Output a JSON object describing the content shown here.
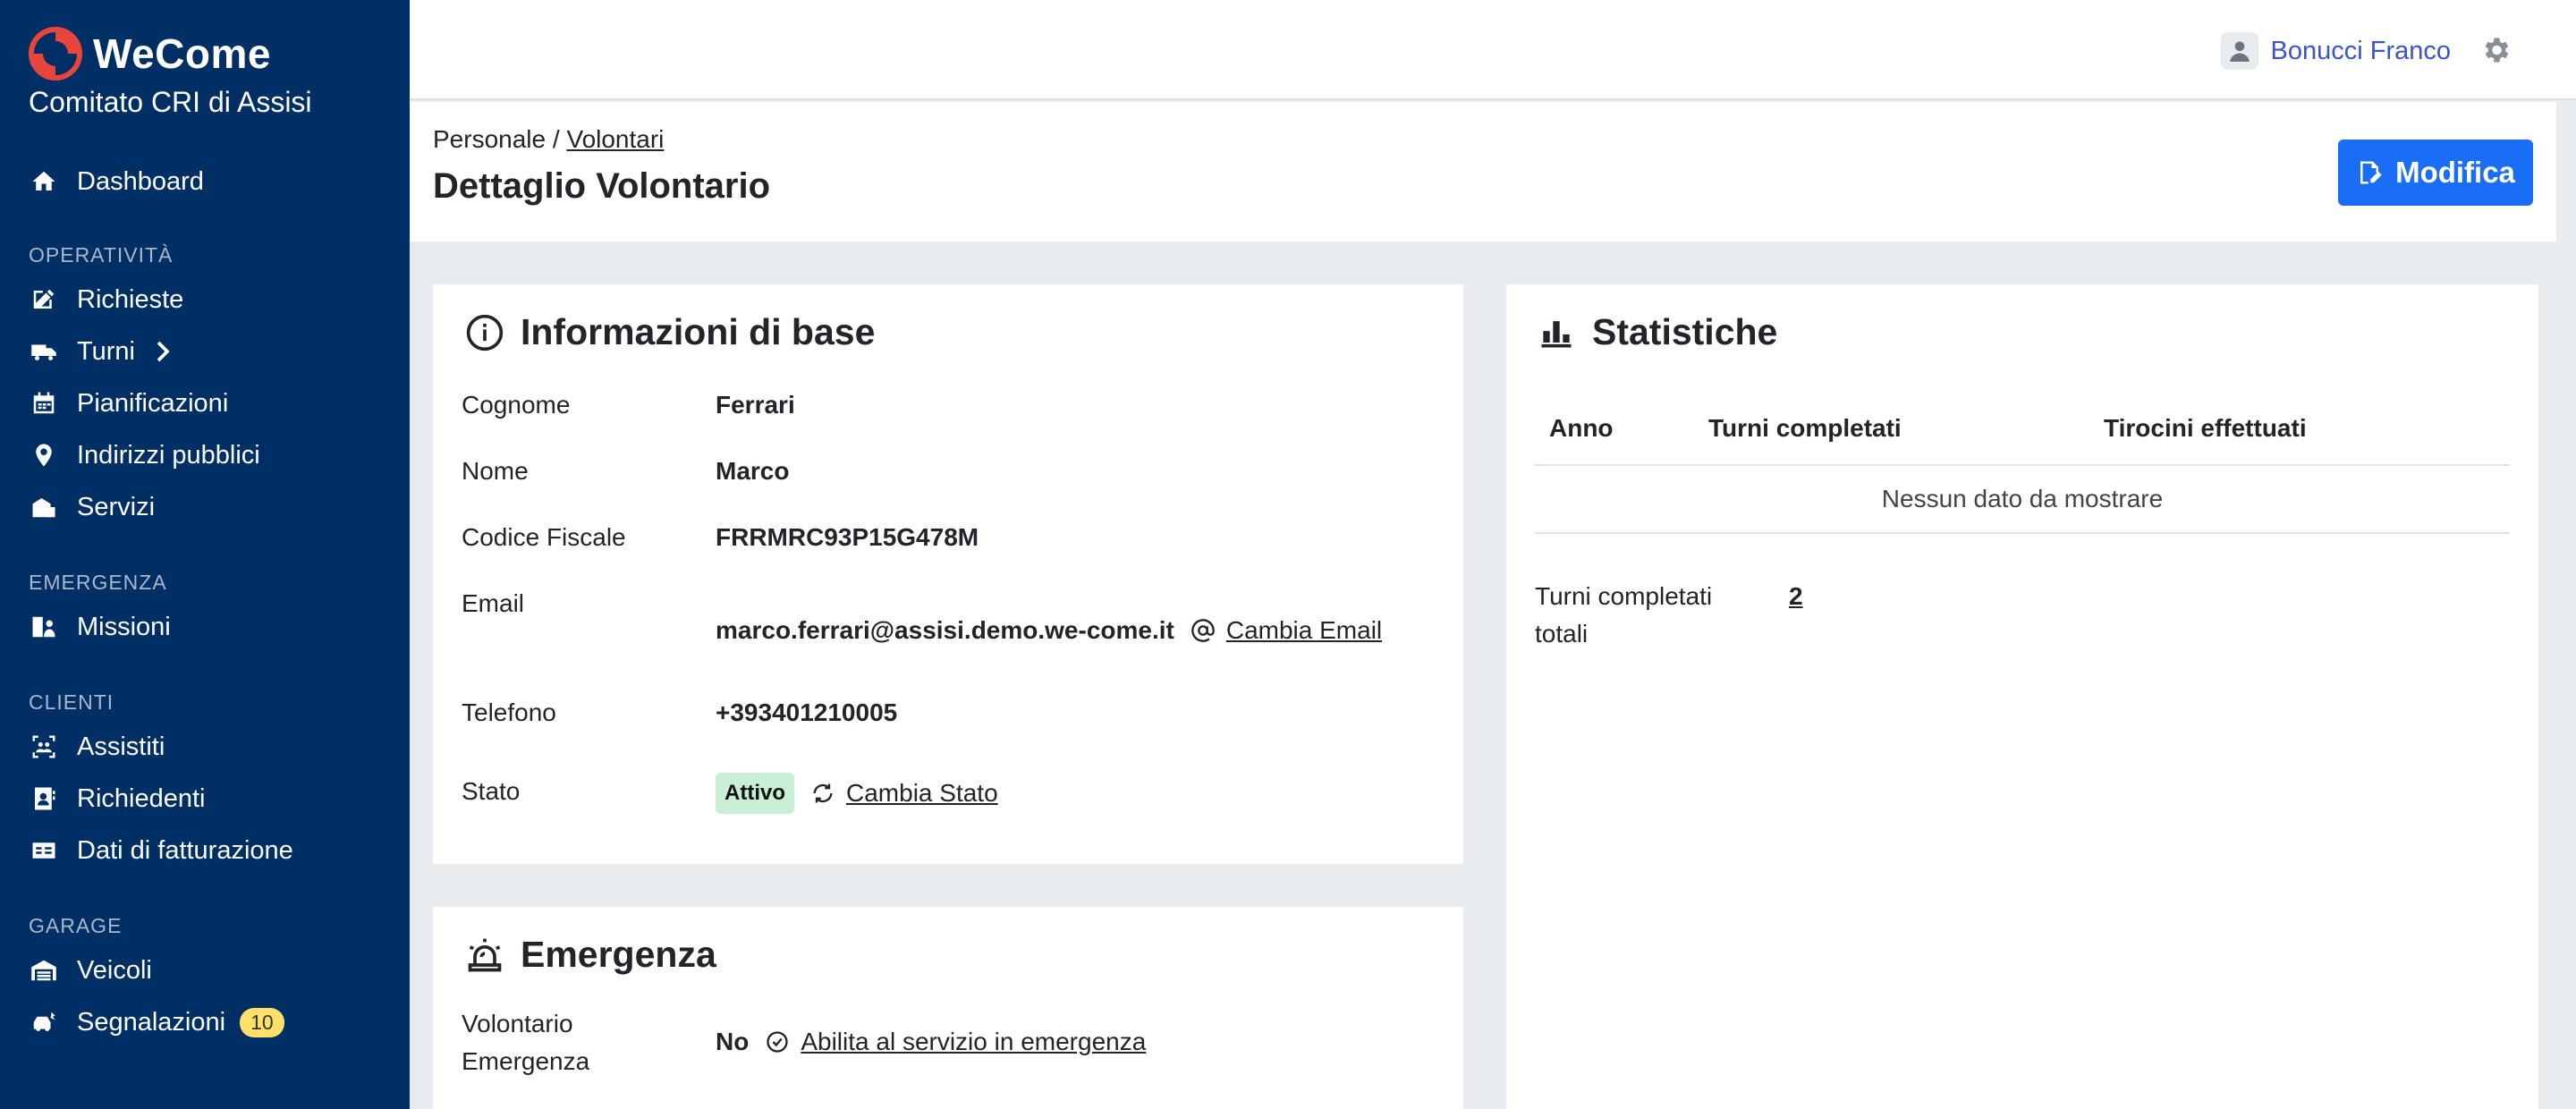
{
  "brand": {
    "name": "WeCome",
    "subtitle": "Comitato CRI di Assisi"
  },
  "sidebar": {
    "dashboard": "Dashboard",
    "sections": {
      "operativita": "OPERATIVITÀ",
      "emergenza": "EMERGENZA",
      "clienti": "CLIENTI",
      "garage": "GARAGE"
    },
    "items": {
      "richieste": "Richieste",
      "turni": "Turni",
      "pianificazioni": "Pianificazioni",
      "indirizzi": "Indirizzi pubblici",
      "servizi": "Servizi",
      "missioni": "Missioni",
      "assistiti": "Assistiti",
      "richiedenti": "Richiedenti",
      "fatturazione": "Dati di fatturazione",
      "veicoli": "Veicoli",
      "segnalazioni": "Segnalazioni",
      "segnalazioni_count": "10"
    }
  },
  "topbar": {
    "user_name": "Bonucci Franco"
  },
  "header": {
    "breadcrumb_root": "Personale",
    "breadcrumb_sep": "/",
    "breadcrumb_link": "Volontari",
    "title": "Dettaglio Volontario",
    "edit_label": "Modifica"
  },
  "info": {
    "title": "Informazioni di base",
    "cognome_label": "Cognome",
    "cognome": "Ferrari",
    "nome_label": "Nome",
    "nome": "Marco",
    "cf_label": "Codice Fiscale",
    "cf": "FRRMRC93P15G478M",
    "email_label": "Email",
    "email": "marco.ferrari@assisi.demo.we-come.it",
    "email_action": "Cambia Email",
    "tel_label": "Telefono",
    "tel": "+393401210005",
    "stato_label": "Stato",
    "stato": "Attivo",
    "stato_action": "Cambia Stato"
  },
  "emergenza": {
    "title": "Emergenza",
    "label": "Volontario Emergenza",
    "value": "No",
    "action": "Abilita al servizio in emergenza"
  },
  "stats": {
    "title": "Statistiche",
    "columns": [
      "Anno",
      "Turni completati",
      "Tirocini effettuati"
    ],
    "empty": "Nessun dato da mostrare",
    "total_label": "Turni completati totali",
    "total_value": "2"
  }
}
